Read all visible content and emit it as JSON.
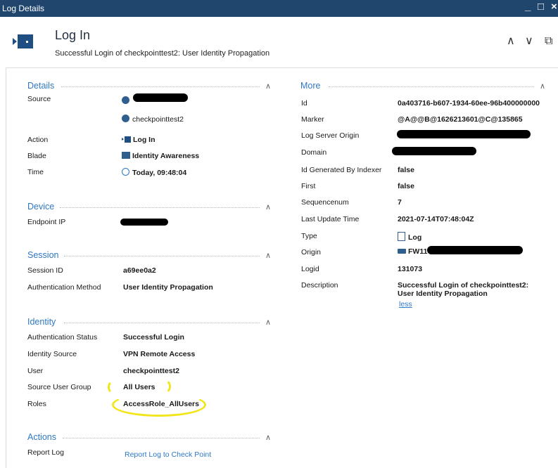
{
  "window": {
    "title": "Log Details",
    "minimize": "_",
    "maximize": "□",
    "close": "×"
  },
  "header": {
    "title": "Log In",
    "subtitle": "Successful Login of checkpointtest2: User Identity Propagation",
    "prev": "∧",
    "next": "∨",
    "copy": "⧉"
  },
  "details": {
    "title": "Details",
    "source_label": "Source",
    "source_user": "checkpointtest2",
    "action_label": "Action",
    "action_value": "Log In",
    "blade_label": "Blade",
    "blade_value": "Identity Awareness",
    "time_label": "Time",
    "time_value": "Today, 09:48:04"
  },
  "device": {
    "title": "Device",
    "endpoint_ip_label": "Endpoint IP"
  },
  "session": {
    "title": "Session",
    "session_id_label": "Session ID",
    "session_id_value": "a69ee0a2",
    "auth_method_label": "Authentication Method",
    "auth_method_value": "User Identity Propagation"
  },
  "identity": {
    "title": "Identity",
    "auth_status_label": "Authentication Status",
    "auth_status_value": "Successful Login",
    "identity_source_label": "Identity Source",
    "identity_source_value": "VPN Remote Access",
    "user_label": "User",
    "user_value": "checkpointtest2",
    "source_user_group_label": "Source User Group",
    "source_user_group_value": "All Users",
    "roles_label": "Roles",
    "roles_value": "AccessRole_AllUsers"
  },
  "actions": {
    "title": "Actions",
    "report_log_label": "Report Log",
    "report_log_link": "Report Log to Check Point"
  },
  "more": {
    "title": "More",
    "id_label": "Id",
    "id_value": "0a403716-b607-1934-60ee-96b400000000",
    "marker_label": "Marker",
    "marker_value": "@A@@B@1626213601@C@135865",
    "log_server_origin_label": "Log Server Origin",
    "domain_label": "Domain",
    "id_generated_label": "Id Generated By Indexer",
    "id_generated_value": "false",
    "first_label": "First",
    "first_value": "false",
    "sequencenum_label": "Sequencenum",
    "sequencenum_value": "7",
    "last_update_label": "Last Update Time",
    "last_update_value": "2021-07-14T07:48:04Z",
    "type_label": "Type",
    "type_value": "Log",
    "origin_label": "Origin",
    "origin_value": "FW11",
    "logid_label": "Logid",
    "logid_value": "131073",
    "description_label": "Description",
    "description_value": "Successful Login of checkpointtest2: User Identity Propagation",
    "less_link": "less"
  },
  "ui": {
    "collapse": "∧"
  }
}
